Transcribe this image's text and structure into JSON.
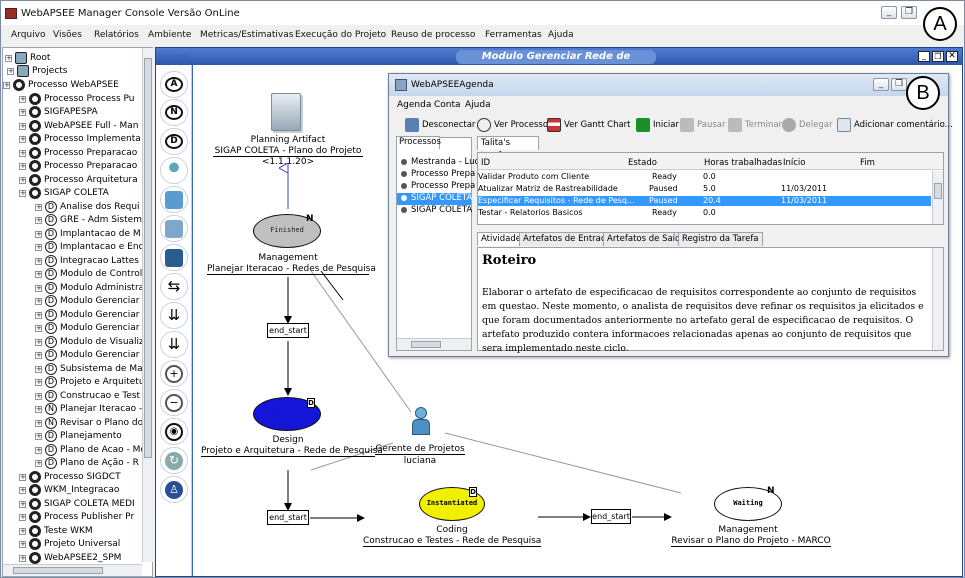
{
  "app": {
    "title": "WebAPSEE Manager Console Versão OnLine"
  },
  "menu": [
    "Arquivo",
    "Visões",
    "Relatórios",
    "Ambiente",
    "Metricas/Estimativas",
    "Execução do Projeto",
    "Reuso de processo",
    "Ferramentas",
    "Ajuda"
  ],
  "tree": {
    "root": "Root",
    "projects": "Projects",
    "items": [
      "Processo WebAPSEE",
      "Processo Process Pu",
      "SIGFAPESPA",
      "WebAPSEE Full - Man",
      "Processo Implementa",
      "Processo Preparacao",
      "Processo Preparacao",
      "Processo Arquitetura",
      "SIGAP COLETA",
      "Analise dos Requi",
      "GRE - Adm Sistem",
      "Implantacao de M",
      "Implantacao e Enc",
      "Integracao Lattes",
      "Modulo de Control",
      "Modulo Administra",
      "Modulo Gerenciar",
      "Modulo Gerenciar",
      "Modulo Gerenciar",
      "Modulo de Visualiz",
      "Modulo Gerenciar",
      "Subsistema de Ma",
      "Projeto e Arquitetu",
      "Construcao e Test",
      "Planejar Iteracao -",
      "Revisar o Plano do",
      "Planejamento",
      "Plano de Acao - Mo",
      "Plano de Ação - R",
      "Processo SIGDCT",
      "WKM_Integracao",
      "SIGAP COLETA MEDI",
      "Process Publisher Pr",
      "Teste WKM",
      "Projeto Universal",
      "WebAPSEE2_SPM"
    ]
  },
  "module": {
    "title": "Modulo Gerenciar Rede de Pesquisa",
    "logo": "WebAPSEE"
  },
  "palette": {
    "letters": [
      "A",
      "N",
      "D"
    ]
  },
  "diagram": {
    "artifact_label": "Planning Artifact",
    "artifact_sub": "SIGAP COLETA - Plano do Projeto",
    "artifact_id": "<1.1.1.20>",
    "n1_state": "Finished",
    "n1_type": "Management",
    "n1_name": "Planejar Iteracao - Redes de Pesquisa",
    "n1_flag": "N",
    "conn1": "end_start",
    "n2_state": "Running",
    "n2_type": "Design",
    "n2_name": "Projeto e Arquitetura - Rede de Pesquisa",
    "n2_flag": "D",
    "conn2": "end_start",
    "n3_state": "Instantiated",
    "n3_type": "Coding",
    "n3_name": "Construcao e Testes - Rede de Pesquisa",
    "n3_flag": "D",
    "conn3": "end_start",
    "n4_state": "Waiting",
    "n4_type": "Management",
    "n4_name": "Revisar o Plano do Projeto - MARCO",
    "n4_flag": "N",
    "agent_role": "Gerente de Projetos",
    "agent_name": "luciana"
  },
  "agenda": {
    "title": "WebAPSEEAgenda",
    "menu": [
      "Agenda",
      "Conta",
      "Ajuda"
    ],
    "toolbar": [
      "Desconectar",
      "Ver Processo",
      "Ver Gantt Chart",
      "Iniciar",
      "Pausar",
      "Terminar",
      "Delegar",
      "Adicionar comentário..."
    ],
    "proc_tab": "Processos",
    "processes": [
      "Mestranda - Luc",
      "Processo Prepa",
      "Processo Prepa",
      "SIGAP COLETA",
      "SIGAP COLETA"
    ],
    "task_tab": "Talita's tarefas",
    "columns": [
      "ID",
      "Estado",
      "Horas trabalhadas",
      "Início",
      "Fim"
    ],
    "rows": [
      {
        "id": "Validar Produto com Cliente",
        "estado": "Ready",
        "horas": "0.0",
        "inicio": ""
      },
      {
        "id": "Atualizar Matriz de Rastreabilidade",
        "estado": "Paused",
        "horas": "5.0",
        "inicio": "11/03/2011"
      },
      {
        "id": "Especificar Requisitos - Rede de Pesq...",
        "estado": "Paused",
        "horas": "20.4",
        "inicio": "11/03/2011"
      },
      {
        "id": "Testar - Relatorios Basicos",
        "estado": "Ready",
        "horas": "0.0",
        "inicio": ""
      }
    ],
    "subtabs": [
      "Atividade",
      "Artefatos de Entrada",
      "Artefatos de Saída",
      "Registro da Tarefa"
    ],
    "heading": "Roteiro",
    "body": "Elaborar o artefato de especificacao de requisitos correspondente ao conjunto de requisitos em questao. Neste momento, o analista de requisitos deve refinar os requisitos ja elicitados e que foram documentados anteriormente no artefato geral de especificacao de requisitos. O artefato produzido contera informacoes relacionadas apenas ao conjunto de requisitos que sera implementado neste ciclo."
  },
  "callouts": [
    "A",
    "B"
  ],
  "colors": {
    "finished": "#c0c0c0",
    "running": "#1515d8",
    "instantiated": "#f0f000",
    "waiting": "#ffffff",
    "selected_row": "#3399ff",
    "module_frame": "#3a64b8"
  }
}
